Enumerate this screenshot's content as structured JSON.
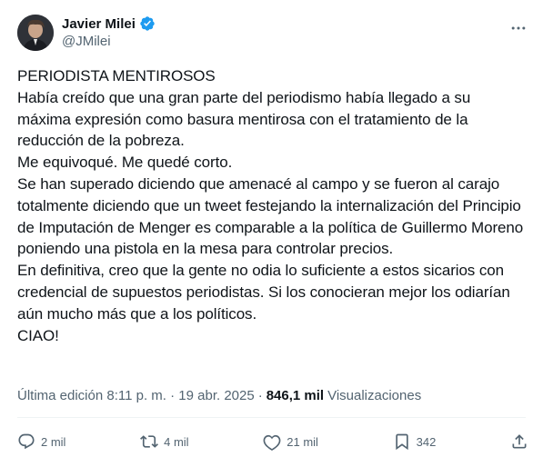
{
  "author": {
    "display_name": "Javier Milei",
    "handle": "@JMilei",
    "verified": true,
    "avatar_icon": "profile-photo"
  },
  "tweet": {
    "text": "PERIODISTA MENTIROSOS\nHabía creído que una gran parte del periodismo había llegado a su máxima expresión como basura mentirosa con el tratamiento de la reducción de la pobreza.\nMe equivoqué. Me quedé corto.\nSe han superado diciendo que amenacé al campo y se fueron al carajo totalmente diciendo que un tweet festejando la internalización del Principio de Imputación de Menger es comparable a la política de Guillermo Moreno poniendo una pistola en la mesa para controlar precios.\nEn definitiva, creo que la gente no odia lo suficiente a estos sicarios con credencial de supuestos periodistas. Si los conocieran mejor los odiarían aún mucho más que a los políticos.\nCIAO!"
  },
  "meta": {
    "edited_label": "Última edición 8:11 p. m. · 19 abr. 2025",
    "separator": "·",
    "views_count": "846,1 mil",
    "views_label": "Visualizaciones"
  },
  "actions": {
    "replies": "2 mil",
    "reposts": "4 mil",
    "likes": "21 mil",
    "bookmarks": "342"
  },
  "colors": {
    "text_primary": "#0f1419",
    "text_secondary": "#536471",
    "verified_blue": "#1d9bf0",
    "divider": "#eff3f4"
  }
}
